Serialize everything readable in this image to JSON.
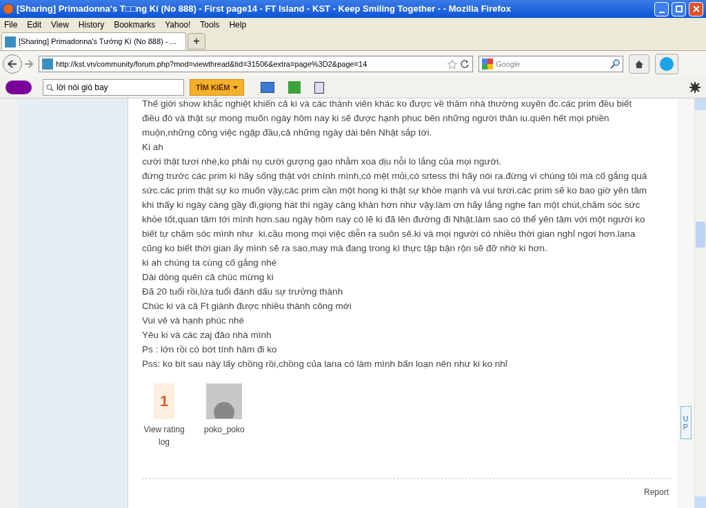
{
  "window": {
    "title": "[Sharing] Primadonna's T□□ng Kí (No 888) - First page14 - FT Island - KST - Keep Smiling Together - - Mozilla Firefox"
  },
  "menu": [
    "File",
    "Edit",
    "View",
    "History",
    "Bookmarks",
    "Yahoo!",
    "Tools",
    "Help"
  ],
  "tabs": [
    {
      "label": "[Sharing] Primadonna's Tướng Kí (No 888) - ...",
      "selected": true
    }
  ],
  "new_tab": "+",
  "address": {
    "value": "http://kst.vn/community/forum.php?mod=viewthread&tid=31506&extra=page%3D2&page=14"
  },
  "search": {
    "placeholder": "Google"
  },
  "yahoo_toolbar": {
    "search_value": "lời nói gió bay",
    "search_button": "TÌM KIẾM"
  },
  "post": {
    "lines": [
      "Thế giới show khắc nghiệt khiến cả ki và các thành viên khác ko được về thăm nhà thường xuyên đc.các prim đều biết",
      "điều đó và thật sự mong muốn ngày hôm nay ki sẽ được hạnh phuc bên những người thân iu.quên hết mọi phiền",
      "muộn,những công việc ngập đầu,cả những ngày dài bên Nhật sắp tới.",
      "Ki ah",
      "cười thật tươi nhé,ko phải nụ cười gượng gạo nhằm xoa dịu nỗi lo lắng của mọi người.",
      "đứng trước các prim ki hãy sống thật với chính mình,có mệt mỏi,có srtess thì hãy nói ra.đừng vì chúng tôi mà cố gắng quá",
      "sức.các prim thật sự ko muốn vậy,các prim cần một hong ki thật sự khỏe mạnh và vui tươi.các prim sẽ ko bao giờ yên tâm",
      "khi thấy ki ngày càng gầy đi,giọng hát thì ngày càng khàn hơn như vậy.làm ơn hãy lắng nghe fan một chút,chăm sóc sức",
      "khỏe tốt,quan tâm tới mình hơn.sau ngày hôm nay có lẽ ki đã lên đường đi Nhật.làm sao có thể yên tâm với một người ko",
      "biết tự chăm sóc mình như  ki.cầu mong mọi việc diễn ra suôn sẻ.ki và mọi người có nhiều thời gian nghỉ ngơi hơn.lana",
      "cũng ko biết thời gian ấy mình sẽ ra sao.may mà đang trong kì thực tập bận rộn sẽ đỡ nhớ ki hơn.",
      "ki ah chúng ta cùng cố gắng nhé",
      "Dài dòng quên cả chúc mừng ki",
      "Đã 20 tuổi rồi,lứa tuổi đánh dấu sự trưởng thành",
      "Chúc ki và cả Ft giành được nhiều thành công mới",
      "Vui vẻ và hạnh phúc nhé",
      "Yêu ki và các zaj đảo nhà mình",
      "Ps : lớn rồi có bớt tính hâm đi ko",
      "Pss: ko bít sau này lấy chồng rồi,chồng của lana có làm mình bấn loạn nên như ki ko nhỉ"
    ],
    "rating_count": "1",
    "rating_link": "View rating log",
    "rater": "poko_poko",
    "report": "Report"
  },
  "up_button": "UP"
}
